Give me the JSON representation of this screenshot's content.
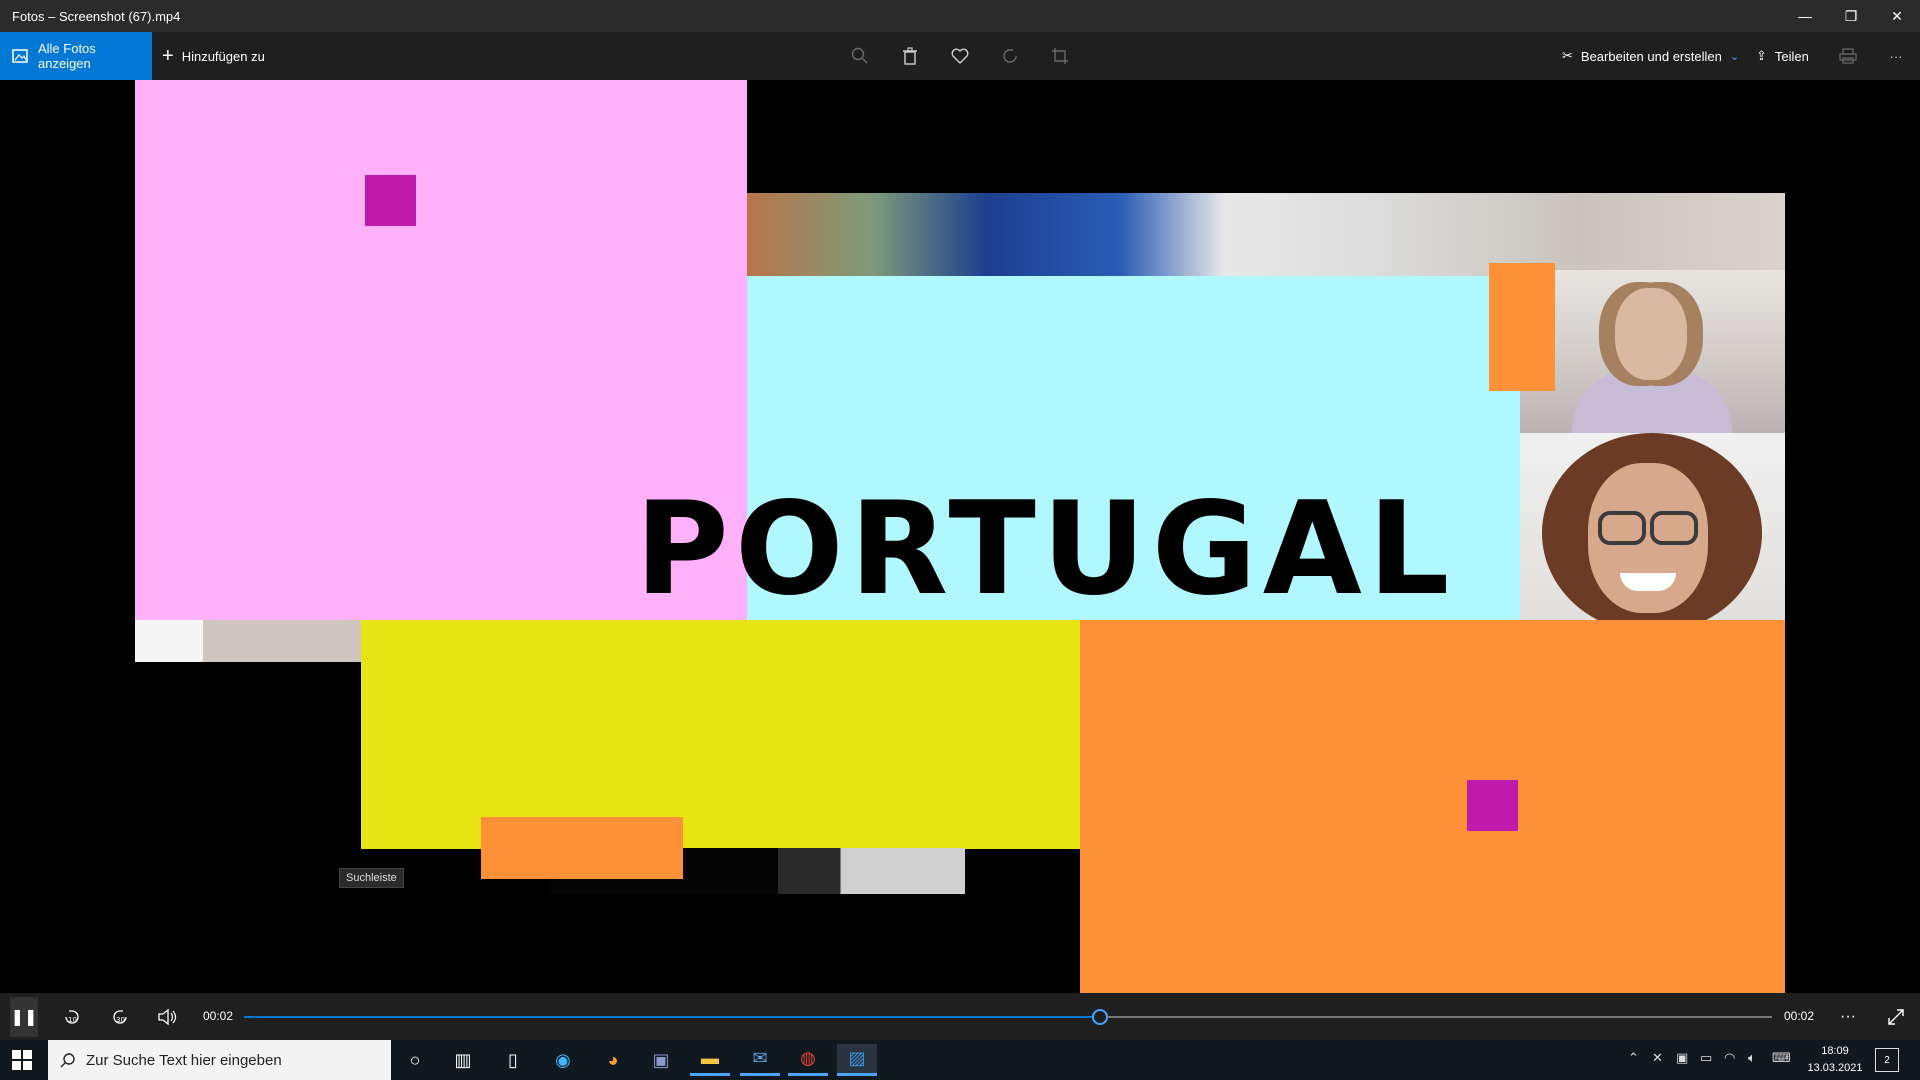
{
  "window": {
    "title": "Fotos – Screenshot (67).mp4",
    "minimize": "—",
    "restore": "❐",
    "close": "✕"
  },
  "toolbar": {
    "all_photos": "Alle Fotos anzeigen",
    "add_to": "Hinzufügen zu",
    "edit_create": "Bearbeiten und erstellen",
    "share": "Teilen",
    "more": "···"
  },
  "video": {
    "headline": "PORTUGAL",
    "tooltip": "Suchleiste"
  },
  "playback": {
    "current_time": "00:02",
    "duration": "00:02",
    "progress": 0.56
  },
  "taskbar": {
    "search_placeholder": "Zur Suche Text hier eingeben",
    "time": "18:09",
    "date": "13.03.2021",
    "notifications": "2"
  },
  "colors": {
    "pink": "#feb0f8",
    "cyan": "#b1f8fe",
    "yellow": "#e7e416",
    "orange": "#fe9038",
    "magenta": "#bf1aaa",
    "accent": "#0078d4"
  }
}
